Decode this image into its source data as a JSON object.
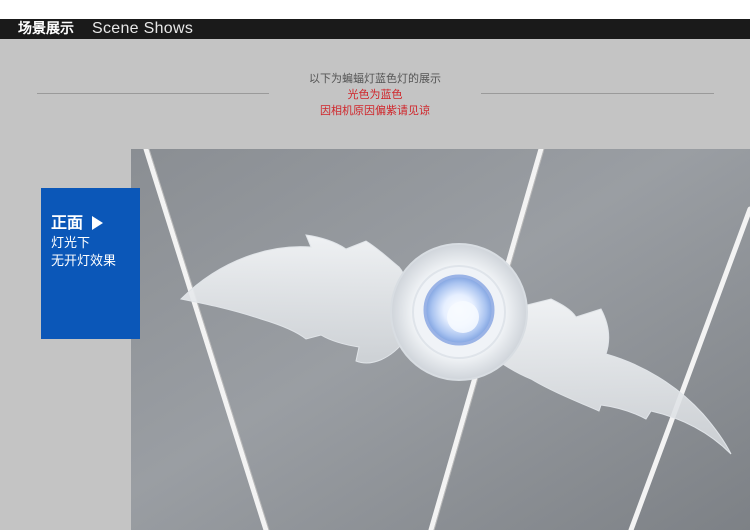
{
  "header": {
    "title_cn": "场景展示",
    "title_en": "Scene Shows"
  },
  "intro": {
    "line1": "以下为蝙蝠灯蓝色灯的展示",
    "line2": "光色为蓝色",
    "line3": "因相机原因偏紫请见谅"
  },
  "card": {
    "title": "正面",
    "line1": "灯光下",
    "line2": "无开灯效果"
  },
  "photo": {
    "subject_icon": "bat-light-icon"
  },
  "colors": {
    "header_bg": "#1a1a1a",
    "page_gray": "#c4c4c4",
    "accent_blue": "#0b57b8",
    "note_red": "#d0262b"
  }
}
